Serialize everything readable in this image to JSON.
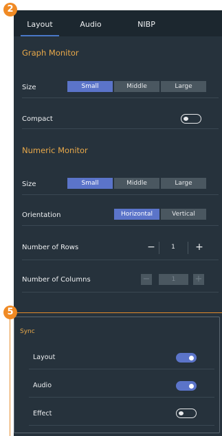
{
  "badges": {
    "top": "2",
    "sync": "5"
  },
  "tabs": [
    {
      "label": "Layout",
      "active": true
    },
    {
      "label": "Audio",
      "active": false
    },
    {
      "label": "NIBP",
      "active": false
    }
  ],
  "graph_monitor": {
    "title": "Graph Monitor",
    "size": {
      "label": "Size",
      "options": [
        "Small",
        "Middle",
        "Large"
      ],
      "selected": "Small"
    },
    "compact": {
      "label": "Compact",
      "on": false
    }
  },
  "numeric_monitor": {
    "title": "Numeric Monitor",
    "size": {
      "label": "Size",
      "options": [
        "Small",
        "Middle",
        "Large"
      ],
      "selected": "Small"
    },
    "orientation": {
      "label": "Orientation",
      "options": [
        "Horizontal",
        "Vertical"
      ],
      "selected": "Horizontal"
    },
    "rows": {
      "label": "Number of Rows",
      "value": "1",
      "minus": "−",
      "plus": "+"
    },
    "columns": {
      "label": "Number of Columns",
      "value": "1",
      "minus": "−",
      "plus": "+",
      "disabled": true
    }
  },
  "sync": {
    "title": "Sync",
    "items": [
      {
        "label": "Layout",
        "on": true
      },
      {
        "label": "Audio",
        "on": true
      },
      {
        "label": "Effect",
        "on": false
      }
    ]
  },
  "colors": {
    "accent": "#5b74c9",
    "section_title": "#e9a94a",
    "badge": "#f08a24",
    "panel": "#26323c"
  }
}
